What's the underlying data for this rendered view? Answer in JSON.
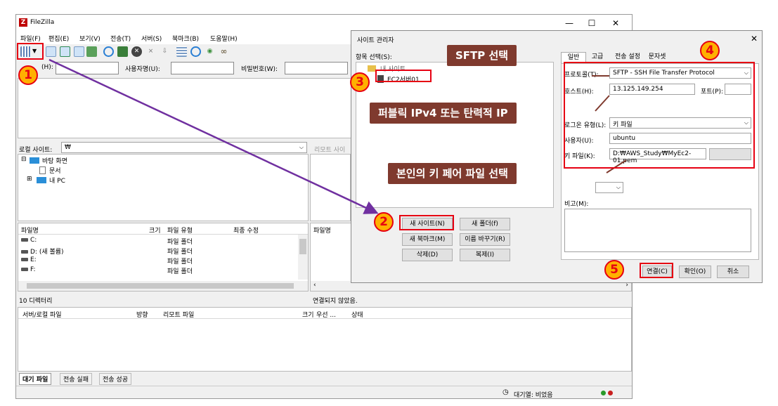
{
  "main_window": {
    "title": "FileZilla",
    "menu": [
      "파일(F)",
      "편집(E)",
      "보기(V)",
      "전송(T)",
      "서버(S)",
      "북마크(B)",
      "도움말(H)"
    ],
    "quick": {
      "host_label": "(H):",
      "user_label": "사용자명(U):",
      "pass_label": "비밀번호(W):"
    },
    "local_site_label": "로컬 사이트:",
    "local_site_value": "₩",
    "remote_site_label": "리모트 사이",
    "tree": [
      "바탕 화면",
      "문서",
      "내 PC"
    ],
    "file_headers": {
      "name": "파일명",
      "size": "크기",
      "type": "파일 유형",
      "modified": "최종 수정"
    },
    "remote_file_header": "파일명",
    "files": [
      {
        "name": "C:",
        "type": "파일 폴더"
      },
      {
        "name": "D: (새 볼륨)",
        "type": "파일 폴더"
      },
      {
        "name": "E:",
        "type": "파일 폴더"
      },
      {
        "name": "F:",
        "type": "파일 폴더"
      }
    ],
    "local_status": "10 디렉터리",
    "remote_status": "연결되지 않았음.",
    "queue_headers": {
      "server_file": "서버/로컬 파일",
      "direction": "방향",
      "remote_file": "리모트 파일",
      "size": "크기",
      "priority": "우선 ...",
      "status": "상태"
    },
    "bottom_tabs": [
      "대기 파일",
      "전송 실패",
      "전송 성공"
    ],
    "queue_status": "대기열: 비었음"
  },
  "site_manager": {
    "title": "사이트 관리자",
    "select_label": "항목 선택(S):",
    "tree_root": "내 사이트",
    "site_entry": "EC2서버01",
    "tabs": [
      "일반",
      "고급",
      "전송 설정",
      "문자셋"
    ],
    "protocol_label": "프로토콜(T):",
    "protocol_value": "SFTP - SSH File Transfer Protocol",
    "host_label": "호스트(H):",
    "host_value": "13.125.149.254",
    "port_label": "포트(P):",
    "port_value": "",
    "logon_label": "로그온 유형(L):",
    "logon_value": "키 파일",
    "user_label": "사용자(U):",
    "user_value": "ubuntu",
    "keyfile_label": "키 파일(K):",
    "keyfile_value": "D:₩AWS_Study₩MyEc2-01.pem",
    "browse_button": "찾아보기...",
    "comment_label": "비고(M):",
    "buttons": {
      "new_site": "새 사이트(N)",
      "new_folder": "새 폴더(f)",
      "new_bookmark": "새 북마크(M)",
      "rename": "이름 바꾸기(R)",
      "delete": "삭제(D)",
      "duplicate": "복제(I)",
      "connect": "연결(C)",
      "ok": "확인(O)",
      "cancel": "취소"
    }
  },
  "annotations": {
    "callout_sftp": "SFTP 선택",
    "callout_ip": "퍼블릭 IPv4 또는 탄력적 IP",
    "callout_key": "본인의 키 페어 파일 선택",
    "steps": [
      "1",
      "2",
      "3",
      "4",
      "5"
    ]
  },
  "colors": {
    "callout_bg": "#7f3a2e",
    "highlight_red": "#e60012",
    "badge_fill": "#ffb000",
    "arrow": "#7030a0"
  }
}
